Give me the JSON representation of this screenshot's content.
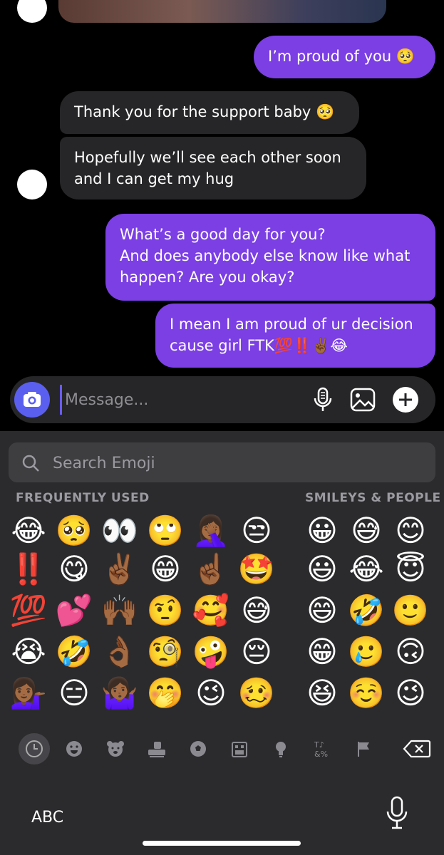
{
  "messages": [
    {
      "side": "out",
      "lines": [
        "I’m proud of you 🥺"
      ]
    },
    {
      "side": "in",
      "lines": [
        "Thank you for the support baby 🥺"
      ]
    },
    {
      "side": "in",
      "lines": [
        "Hopefully we’ll see each other soon",
        "and I can get my hug"
      ]
    },
    {
      "side": "out",
      "lines": [
        "What’s a good day for you?",
        "And does anybody else know like what",
        "happen? Are you okay?"
      ]
    },
    {
      "side": "out",
      "lines": [
        "I mean I am proud of ur decision",
        "cause girl FTK💯‼️✌🏾😂"
      ]
    }
  ],
  "composer": {
    "placeholder": "Message...",
    "camera_icon": "camera-icon",
    "icons": [
      "microphone-icon",
      "gallery-icon",
      "plus-icon"
    ]
  },
  "keyboard": {
    "search_placeholder": "Search Emoji",
    "sections": {
      "frequently_used": "FREQUENTLY USED",
      "smileys": "SMILEYS & PEOPLE"
    },
    "frequently_used": [
      [
        "😂",
        "🥺",
        "👀",
        "🙄",
        "🤦🏾‍♀️",
        "😒"
      ],
      [
        "‼️",
        "😋",
        "✌🏾",
        "😁",
        "☝🏾",
        "🤩"
      ],
      [
        "💯",
        "💕",
        "🙌🏾",
        "🤨",
        "🥰",
        "😅"
      ],
      [
        "😭",
        "🤣",
        "👌🏾",
        "🧐",
        "🤪",
        "😔"
      ],
      [
        "💁🏾‍♀️",
        "😑",
        "🤷🏾‍♀️",
        "🤭",
        "😉",
        "🥴"
      ]
    ],
    "smileys": [
      [
        "😀",
        "😅",
        "😊"
      ],
      [
        "😃",
        "😂",
        "😇"
      ],
      [
        "😄",
        "🤣",
        "🙂"
      ],
      [
        "😁",
        "🥲",
        "🙃"
      ],
      [
        "😆",
        "☺️",
        "😉"
      ]
    ],
    "categories": [
      "recent-clock-icon",
      "smiley-icon",
      "bear-icon",
      "food-icon",
      "ball-icon",
      "building-icon",
      "lightbulb-icon",
      "symbols-icon",
      "flag-icon"
    ],
    "abc_label": "ABC"
  }
}
